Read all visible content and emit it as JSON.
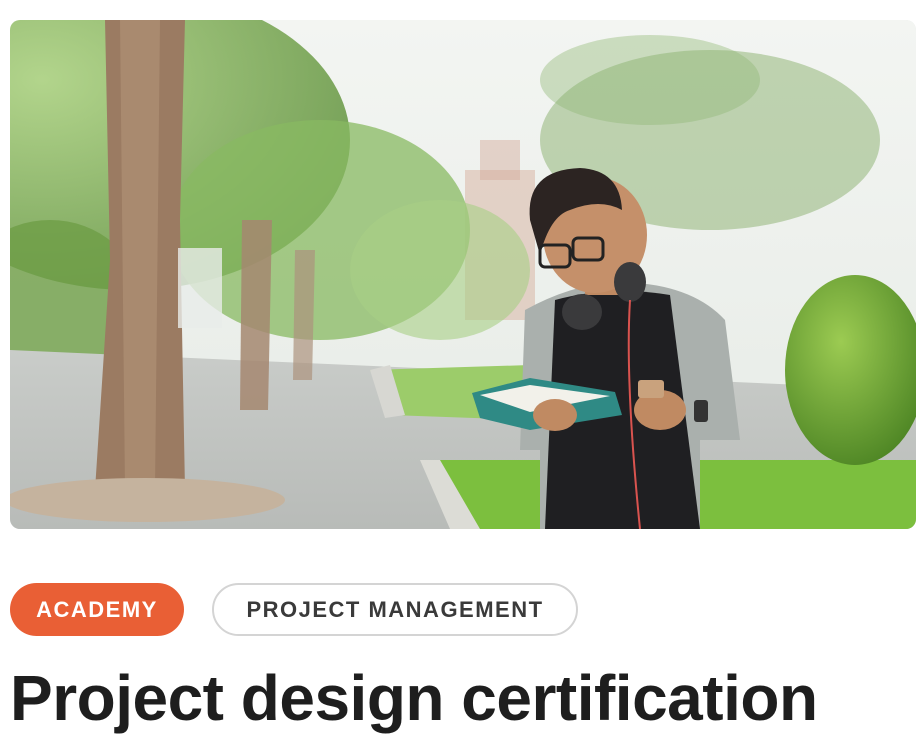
{
  "hero": {
    "image_description_name": "hero-photo"
  },
  "tags": {
    "primary": "ACADEMY",
    "secondary": "PROJECT MANAGEMENT"
  },
  "title": "Project design certification",
  "colors": {
    "primary_tag": "#e95f35",
    "secondary_tag_border": "#d4d4d4",
    "title_text": "#1e1e1e"
  }
}
